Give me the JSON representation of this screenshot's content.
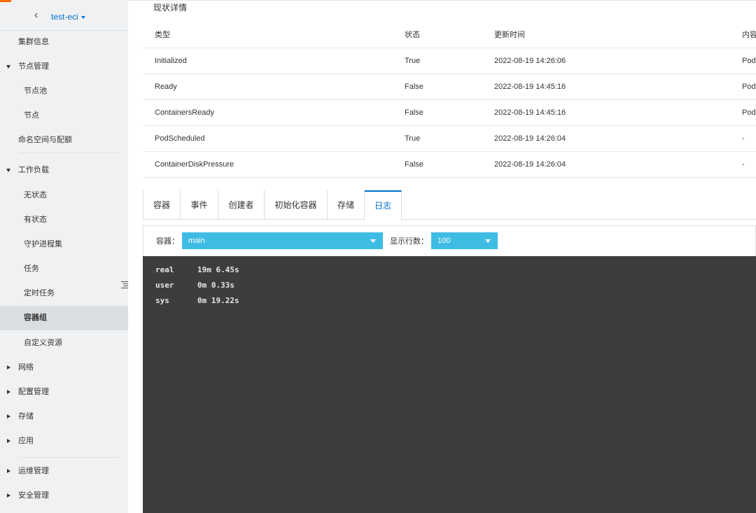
{
  "sidebar": {
    "back_glyph": "‹",
    "cluster_name": "test-eci",
    "items": [
      {
        "label": "集群信息",
        "kind": "top",
        "arrow": "none"
      },
      {
        "label": "节点管理",
        "kind": "top",
        "arrow": "down"
      },
      {
        "label": "节点池",
        "kind": "sub"
      },
      {
        "label": "节点",
        "kind": "sub"
      },
      {
        "label": "命名空间与配额",
        "kind": "top",
        "arrow": "none"
      },
      {
        "label": "工作负载",
        "kind": "top",
        "arrow": "down"
      },
      {
        "label": "无状态",
        "kind": "sub"
      },
      {
        "label": "有状态",
        "kind": "sub"
      },
      {
        "label": "守护进程集",
        "kind": "sub"
      },
      {
        "label": "任务",
        "kind": "sub"
      },
      {
        "label": "定时任务",
        "kind": "sub"
      },
      {
        "label": "容器组",
        "kind": "sub",
        "active": true
      },
      {
        "label": "自定义资源",
        "kind": "sub"
      },
      {
        "label": "网络",
        "kind": "top",
        "arrow": "right"
      },
      {
        "label": "配置管理",
        "kind": "top",
        "arrow": "right"
      },
      {
        "label": "存储",
        "kind": "top",
        "arrow": "right"
      },
      {
        "label": "应用",
        "kind": "top",
        "arrow": "right"
      },
      {
        "label": "运维管理",
        "kind": "top",
        "arrow": "right"
      },
      {
        "label": "安全管理",
        "kind": "top",
        "arrow": "right"
      }
    ]
  },
  "conditions": {
    "title": "现状详情",
    "headers": {
      "type": "类型",
      "status": "状态",
      "time": "更新时间",
      "content": "内容"
    },
    "rows": [
      {
        "type": "Initialized",
        "status": "True",
        "time": "2022-08-19 14:26:06",
        "content": "Pod"
      },
      {
        "type": "Ready",
        "status": "False",
        "time": "2022-08-19 14:45:16",
        "content": "Pod"
      },
      {
        "type": "ContainersReady",
        "status": "False",
        "time": "2022-08-19 14:45:16",
        "content": "Pod"
      },
      {
        "type": "PodScheduled",
        "status": "True",
        "time": "2022-08-19 14:26:04",
        "content": "-"
      },
      {
        "type": "ContainerDiskPressure",
        "status": "False",
        "time": "2022-08-19 14:26:04",
        "content": "-"
      }
    ]
  },
  "tabs": [
    "容器",
    "事件",
    "创建者",
    "初始化容器",
    "存储",
    "日志"
  ],
  "active_tab": "日志",
  "log": {
    "container_label": "容器：",
    "container_value": "main",
    "lines_label": "显示行数：",
    "lines_value": "100",
    "output": [
      {
        "key": "real",
        "value": "19m 6.45s"
      },
      {
        "key": "user",
        "value": "0m 0.33s"
      },
      {
        "key": "sys",
        "value": "0m 19.22s"
      }
    ]
  },
  "colors": {
    "accent": "#0070cc",
    "select_bg": "#3fbce3",
    "log_bg": "#3d3d3d",
    "brand": "#ff6a00"
  }
}
